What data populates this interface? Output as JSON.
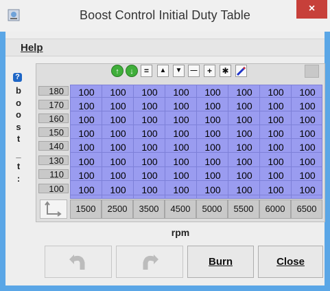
{
  "window": {
    "title": "Boost Control Initial Duty Table",
    "close_glyph": "×"
  },
  "menu": {
    "help_label": "Help"
  },
  "side_label": {
    "icon": "question-icon",
    "letters": [
      "b",
      "o",
      "o",
      "s",
      "t",
      "_",
      "t",
      ":"
    ]
  },
  "toolbar": {
    "icons": [
      "rotate-up-icon",
      "rotate-down-icon",
      "equals-icon",
      "increment-icon",
      "decrement-icon",
      "minus-icon",
      "plus-icon",
      "multiply-icon",
      "pencil-icon",
      "blank-icon"
    ],
    "equals": "=",
    "up": "▲",
    "down": "▼",
    "minus": "—",
    "plus": "+",
    "multiply": "✱"
  },
  "table": {
    "row_labels": [
      "180",
      "170",
      "160",
      "150",
      "140",
      "130",
      "110",
      "100"
    ],
    "col_labels": [
      "1500",
      "2500",
      "3500",
      "4500",
      "5000",
      "5500",
      "6000",
      "6500"
    ],
    "values": [
      [
        "100",
        "100",
        "100",
        "100",
        "100",
        "100",
        "100",
        "100"
      ],
      [
        "100",
        "100",
        "100",
        "100",
        "100",
        "100",
        "100",
        "100"
      ],
      [
        "100",
        "100",
        "100",
        "100",
        "100",
        "100",
        "100",
        "100"
      ],
      [
        "100",
        "100",
        "100",
        "100",
        "100",
        "100",
        "100",
        "100"
      ],
      [
        "100",
        "100",
        "100",
        "100",
        "100",
        "100",
        "100",
        "100"
      ],
      [
        "100",
        "100",
        "100",
        "100",
        "100",
        "100",
        "100",
        "100"
      ],
      [
        "100",
        "100",
        "100",
        "100",
        "100",
        "100",
        "100",
        "100"
      ],
      [
        "100",
        "100",
        "100",
        "100",
        "100",
        "100",
        "100",
        "100"
      ]
    ],
    "x_axis_label": "rpm",
    "cell_color": "#9a9cf0"
  },
  "buttons": {
    "undo_icon": "undo-icon",
    "redo_icon": "redo-icon",
    "burn": "Burn",
    "close": "Close"
  },
  "colors": {
    "close_button": "#c7403a",
    "accent": "#5aa6e6"
  }
}
